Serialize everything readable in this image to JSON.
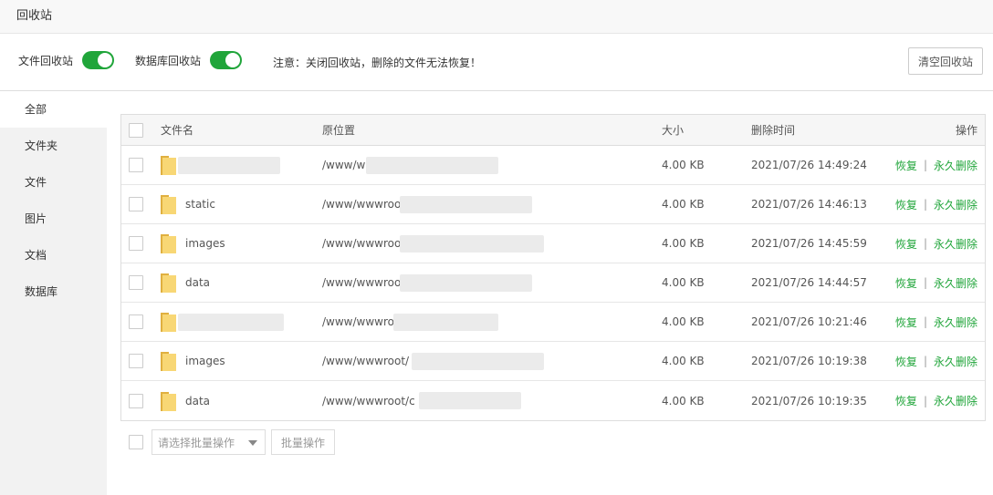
{
  "window": {
    "title": "回收站"
  },
  "topbar": {
    "file_recycle_label": "文件回收站",
    "db_recycle_label": "数据库回收站",
    "notice": "注意：关闭回收站，删除的文件无法恢复！",
    "clear_button": "清空回收站"
  },
  "sidebar": {
    "items": [
      {
        "label": "全部"
      },
      {
        "label": "文件夹"
      },
      {
        "label": "文件"
      },
      {
        "label": "图片"
      },
      {
        "label": "文档"
      },
      {
        "label": "数据库"
      }
    ]
  },
  "table": {
    "headers": {
      "name": "文件名",
      "path": "原位置",
      "size": "大小",
      "time": "删除时间",
      "ops": "操作"
    },
    "actions": {
      "restore": "恢复",
      "separator": "|",
      "delete": "永久删除"
    },
    "rows": [
      {
        "name": "",
        "path": "/www/w",
        "size": "4.00 KB",
        "time": "2021/07/26 14:49:24"
      },
      {
        "name": "static",
        "path": "/www/wwwroo",
        "size": "4.00 KB",
        "time": "2021/07/26 14:46:13"
      },
      {
        "name": "images",
        "path": "/www/wwwroo",
        "size": "4.00 KB",
        "time": "2021/07/26 14:45:59"
      },
      {
        "name": "data",
        "path": "/www/wwwroo",
        "size": "4.00 KB",
        "time": "2021/07/26 14:44:57"
      },
      {
        "name": "",
        "path": "/www/wwwro",
        "size": "4.00 KB",
        "time": "2021/07/26 10:21:46"
      },
      {
        "name": "images",
        "path": "/www/wwwroot/",
        "size": "4.00 KB",
        "time": "2021/07/26 10:19:38"
      },
      {
        "name": "data",
        "path": "/www/wwwroot/c",
        "size": "4.00 KB",
        "time": "2021/07/26 10:19:35"
      }
    ]
  },
  "footer": {
    "batch_select_placeholder": "请选择批量操作",
    "batch_button": "批量操作"
  },
  "colors": {
    "accent": "#20a53a"
  }
}
